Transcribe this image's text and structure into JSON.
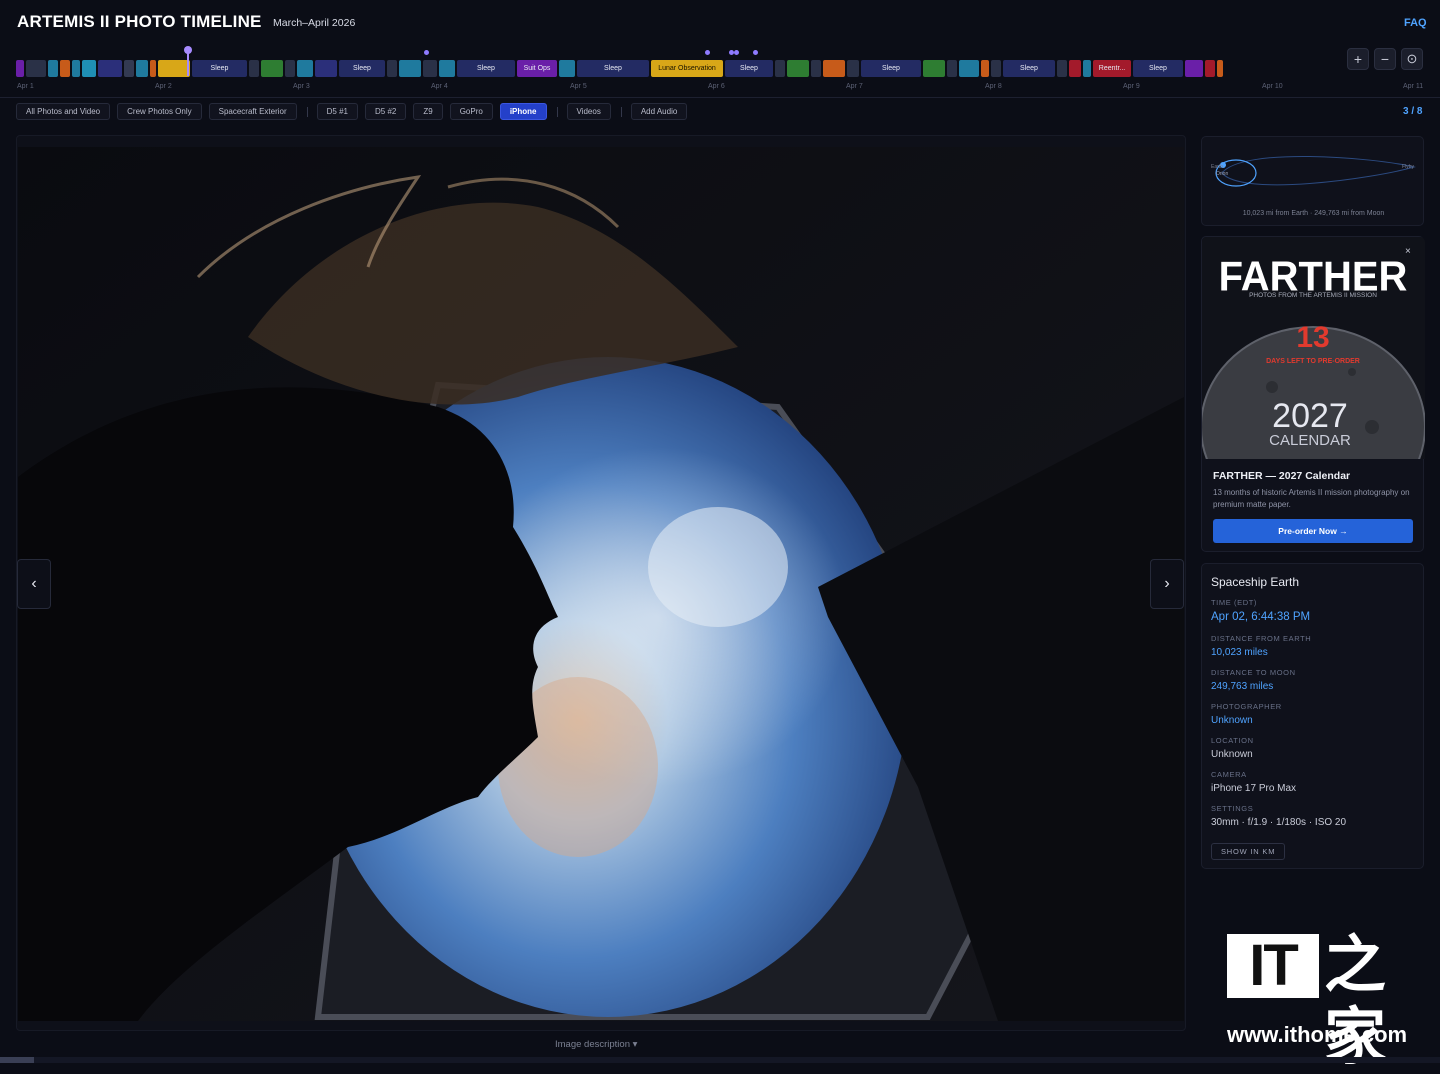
{
  "header": {
    "title": "ARTEMIS II PHOTO TIMELINE",
    "subtitle": "March–April 2026",
    "faq": "FAQ"
  },
  "timeline": {
    "segments": [
      {
        "label": "",
        "color": "#6a1fa8",
        "w": 8
      },
      {
        "label": "",
        "color": "#2a3147",
        "w": 20
      },
      {
        "label": "",
        "color": "#1f7a9e",
        "w": 10
      },
      {
        "label": "",
        "color": "#c75b1a",
        "w": 10
      },
      {
        "label": "",
        "color": "#1f7a9e",
        "w": 8
      },
      {
        "label": "",
        "color": "#1f8fb5",
        "w": 14
      },
      {
        "label": "",
        "color": "#2b2f7a",
        "w": 24
      },
      {
        "label": "",
        "color": "#333a52",
        "w": 10
      },
      {
        "label": "",
        "color": "#1f7a9e",
        "w": 12
      },
      {
        "label": "",
        "color": "#c75b1a",
        "w": 6
      },
      {
        "label": "",
        "color": "#d8a718",
        "w": 32
      },
      {
        "label": "Sleep",
        "color": "#232b63",
        "w": 55
      },
      {
        "label": "",
        "color": "#2a3147",
        "w": 10
      },
      {
        "label": "",
        "color": "#2e7d32",
        "w": 22
      },
      {
        "label": "",
        "color": "#2a3147",
        "w": 10
      },
      {
        "label": "",
        "color": "#1f7a9e",
        "w": 16
      },
      {
        "label": "",
        "color": "#2b2f7a",
        "w": 22
      },
      {
        "label": "Sleep",
        "color": "#232b63",
        "w": 46
      },
      {
        "label": "",
        "color": "#2a3147",
        "w": 10
      },
      {
        "label": "",
        "color": "#1f7a9e",
        "w": 22
      },
      {
        "label": "",
        "color": "#2a3147",
        "w": 14
      },
      {
        "label": "",
        "color": "#1f7a9e",
        "w": 16
      },
      {
        "label": "Sleep",
        "color": "#232b63",
        "w": 58
      },
      {
        "label": "Suit Ops",
        "color": "#6a1fa8",
        "w": 40
      },
      {
        "label": "",
        "color": "#1f7a9e",
        "w": 16
      },
      {
        "label": "Sleep",
        "color": "#232b63",
        "w": 72
      },
      {
        "label": "Lunar Observation",
        "color": "#d8a718",
        "w": 72
      },
      {
        "label": "Sleep",
        "color": "#232b63",
        "w": 48
      },
      {
        "label": "",
        "color": "#2a3147",
        "w": 10
      },
      {
        "label": "",
        "color": "#2e7d32",
        "w": 22
      },
      {
        "label": "",
        "color": "#2a3147",
        "w": 10
      },
      {
        "label": "",
        "color": "#c75b1a",
        "w": 22
      },
      {
        "label": "",
        "color": "#2a3147",
        "w": 12
      },
      {
        "label": "Sleep",
        "color": "#232b63",
        "w": 60
      },
      {
        "label": "",
        "color": "#2e7d32",
        "w": 22
      },
      {
        "label": "",
        "color": "#2a3147",
        "w": 10
      },
      {
        "label": "",
        "color": "#1f7a9e",
        "w": 20
      },
      {
        "label": "",
        "color": "#c75b1a",
        "w": 8
      },
      {
        "label": "",
        "color": "#2a3147",
        "w": 10
      },
      {
        "label": "Sleep",
        "color": "#232b63",
        "w": 52
      },
      {
        "label": "",
        "color": "#2a3147",
        "w": 10
      },
      {
        "label": "",
        "color": "#a31a2b",
        "w": 12
      },
      {
        "label": "",
        "color": "#1f7a9e",
        "w": 8
      },
      {
        "label": "Reentr...",
        "color": "#a31a2b",
        "w": 38
      },
      {
        "label": "Sleep",
        "color": "#232b63",
        "w": 50
      },
      {
        "label": "",
        "color": "#6a1fa8",
        "w": 18
      },
      {
        "label": "",
        "color": "#a31a2b",
        "w": 10
      },
      {
        "label": "",
        "color": "#c75b1a",
        "w": 6
      }
    ],
    "days": [
      "Apr 1",
      "Apr 2",
      "Apr 3",
      "Apr 4",
      "Apr 5",
      "Apr 6",
      "Apr 7",
      "Apr 8",
      "Apr 9",
      "Apr 10",
      "Apr 11"
    ]
  },
  "zoom": {
    "in": "+",
    "out": "−",
    "reset": "⊙"
  },
  "filters": [
    {
      "label": "All Photos and Video",
      "active": false,
      "sep": false
    },
    {
      "label": "Crew Photos Only",
      "active": false,
      "sep": false
    },
    {
      "label": "Spacecraft Exterior",
      "active": false,
      "sep": true
    },
    {
      "label": "D5 #1",
      "active": false,
      "sep": false
    },
    {
      "label": "D5 #2",
      "active": false,
      "sep": false
    },
    {
      "label": "Z9",
      "active": false,
      "sep": false
    },
    {
      "label": "GoPro",
      "active": false,
      "sep": false
    },
    {
      "label": "iPhone",
      "active": true,
      "sep": true
    },
    {
      "label": "Videos",
      "active": false,
      "sep": true
    },
    {
      "label": "Add Audio",
      "active": false,
      "sep": false
    }
  ],
  "counter": "3 / 8",
  "viewer": {
    "prev": "‹",
    "next": "›",
    "image_description": "Image description ▾"
  },
  "orbit": {
    "earth_label": "Earth",
    "orion_label": "Orion",
    "flyby_label": "Flyby",
    "caption": "10,023 mi from Earth · 249,763 mi from Moon"
  },
  "ad": {
    "close": "×",
    "brand": "FARTHER",
    "tagline": "PHOTOS FROM THE ARTEMIS II MISSION",
    "days_num": "13",
    "days_text": "DAYS LEFT TO PRE-ORDER",
    "year": "2027",
    "calendar": "CALENDAR",
    "title": "FARTHER — 2027 Calendar",
    "desc": "13 months of historic Artemis II mission photography on premium matte paper.",
    "cta": "Pre-order Now →"
  },
  "info": {
    "title": "Spaceship Earth",
    "time_label": "TIME (EDT)",
    "time": "Apr 02, 6:44:38 PM",
    "dist_earth_label": "DISTANCE FROM EARTH",
    "dist_earth": "10,023 miles",
    "dist_moon_label": "DISTANCE TO MOON",
    "dist_moon": "249,763 miles",
    "photographer_label": "PHOTOGRAPHER",
    "photographer": "Unknown",
    "location_label": "LOCATION",
    "location": "Unknown",
    "camera_label": "CAMERA",
    "camera": "iPhone 17 Pro Max",
    "settings_label": "SETTINGS",
    "settings": "30mm · f/1.9 · 1/180s · ISO 20",
    "km_button": "SHOW IN KM"
  },
  "watermark": {
    "it": "IT",
    "home": "之家",
    "url": "www.ithome.com"
  }
}
